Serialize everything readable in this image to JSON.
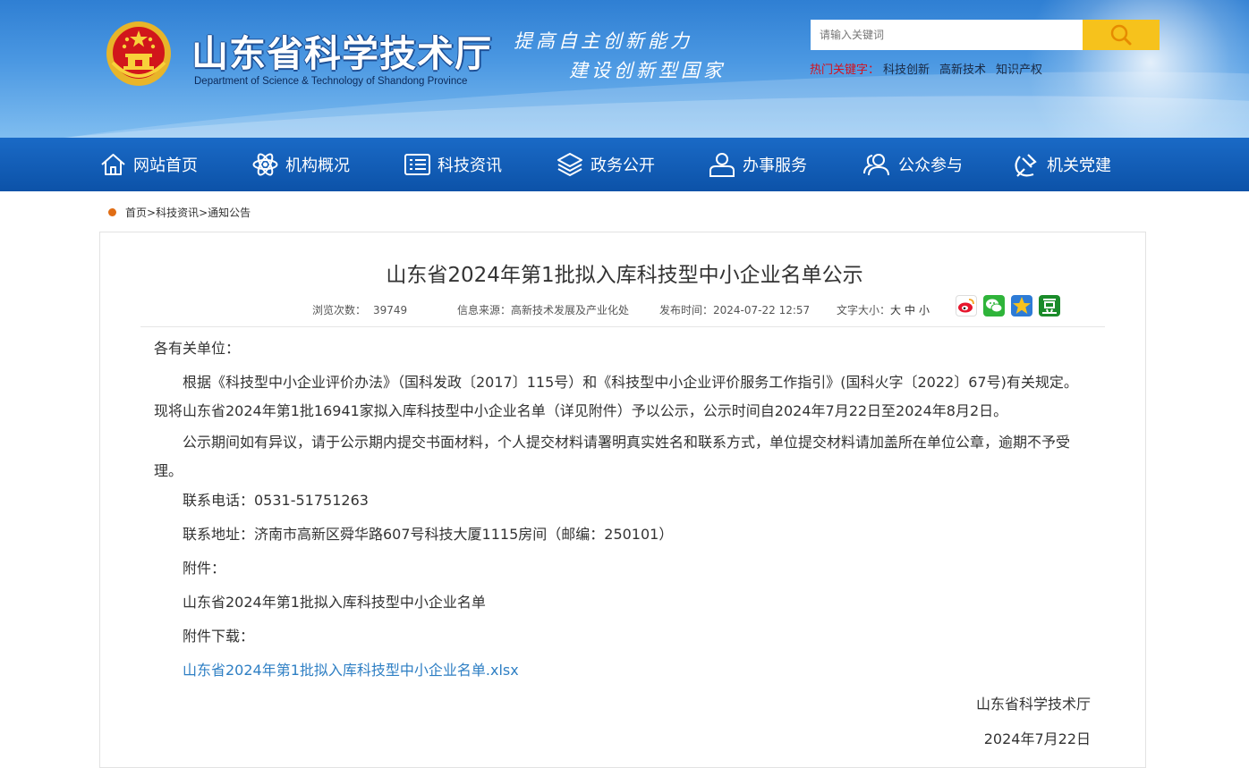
{
  "header": {
    "title": "山东省科学技术厅",
    "subtitle_en": "Department of Science & Technology of Shandong Province",
    "slogan_line1": "提高自主创新能力",
    "slogan_line2": "建设创新型国家",
    "search_placeholder": "请输入关键词",
    "hot_label": "热门关键字：",
    "hot_keywords": [
      "科技创新",
      "高新技术",
      "知识产权"
    ]
  },
  "nav": {
    "items": [
      {
        "label": "网站首页",
        "icon": "home-icon"
      },
      {
        "label": "机构概况",
        "icon": "atom-icon"
      },
      {
        "label": "科技资讯",
        "icon": "news-icon"
      },
      {
        "label": "政务公开",
        "icon": "layers-icon"
      },
      {
        "label": "办事服务",
        "icon": "user-service-icon"
      },
      {
        "label": "公众参与",
        "icon": "people-icon"
      },
      {
        "label": "机关党建",
        "icon": "party-icon"
      }
    ]
  },
  "breadcrumb": {
    "items": [
      "首页",
      "科技资讯",
      "通知公告"
    ],
    "separator": ">"
  },
  "article": {
    "title": "山东省2024年第1批拟入库科技型中小企业名单公示",
    "views_label": "浏览次数：",
    "views": "39749",
    "source_label": "信息来源：",
    "source": "高新技术发展及产业化处",
    "date_label": "发布时间：",
    "date": "2024-07-22 12:57",
    "fontsize_label": "文字大小：",
    "fontsize_options": [
      "大",
      "中",
      "小"
    ],
    "share": [
      "weibo-icon",
      "wechat-icon",
      "qzone-icon",
      "douban-icon"
    ],
    "salutation": "各有关单位：",
    "para1": "根据《科技型中小企业评价办法》（国科发政〔2017〕115号）和《科技型中小企业评价服务工作指引》(国科火字〔2022〕67号)有关规定。现将山东省2024年第1批16941家拟入库科技型中小企业名单（详见附件）予以公示，公示时间自2024年7月22日至2024年8月2日。",
    "para2": "公示期间如有异议，请于公示期内提交书面材料，个人提交材料请署明真实姓名和联系方式，单位提交材料请加盖所在单位公章，逾期不予受理。",
    "phone": "联系电话：0531-51751263",
    "address": "联系地址：济南市高新区舜华路607号科技大厦1115房间（邮编：250101）",
    "attachment_label": "附件：",
    "attachment_name": "山东省2024年第1批拟入库科技型中小企业名单",
    "download_label": "附件下载：",
    "download_link": "山东省2024年第1批拟入库科技型中小企业名单.xlsx",
    "signature": "山东省科学技术厅",
    "sign_date": "2024年7月22日"
  },
  "colors": {
    "nav_bg": "#0f58ae",
    "search_button": "#f6c21c",
    "hot_label": "#d4111e",
    "link": "#2e7fc4",
    "breadcrumb_dot": "#e06d14"
  }
}
